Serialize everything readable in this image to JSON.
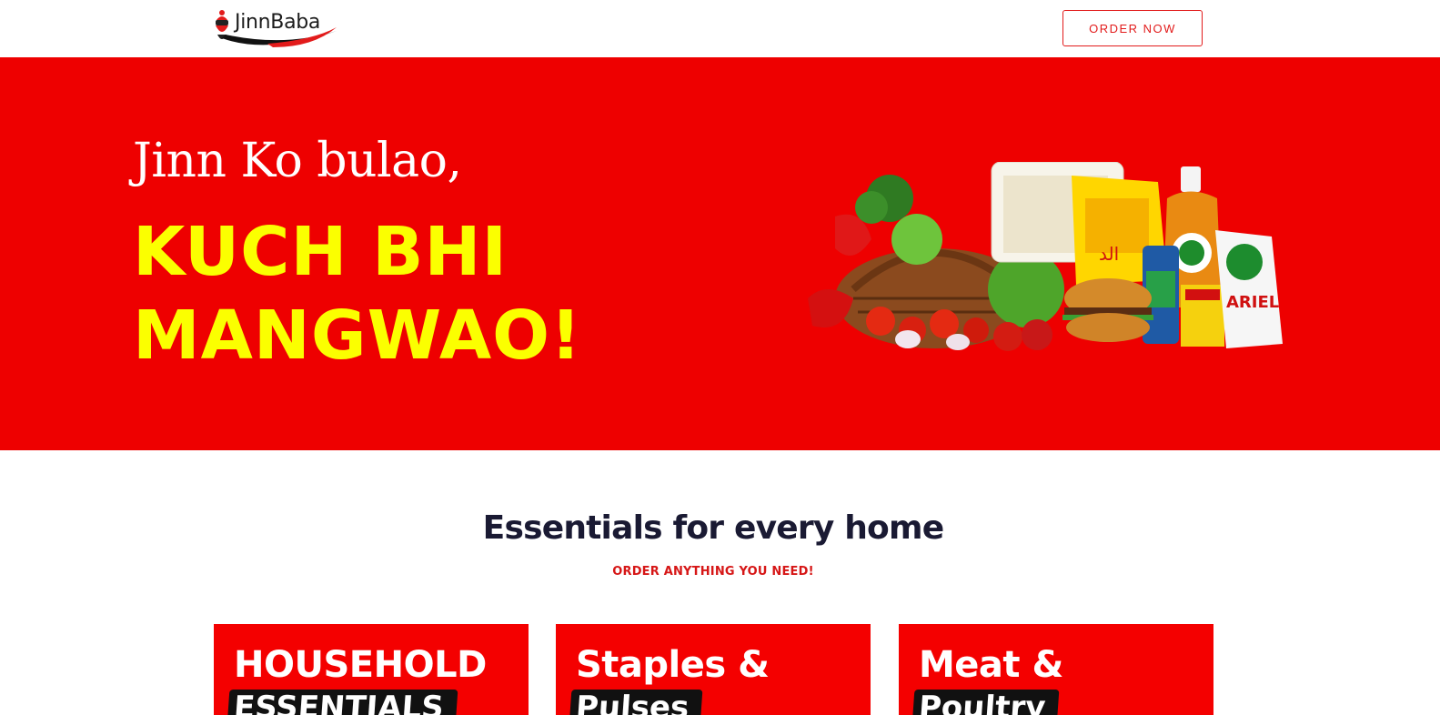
{
  "header": {
    "logo_text": "JinnBaba",
    "order_button": "ORDER NOW"
  },
  "hero": {
    "tagline": "Jinn Ko bulao,",
    "headline_1": "KUCH BHI",
    "headline_2": "MANGWAO!",
    "image_label": "grocery-products-image"
  },
  "section": {
    "title": "Essentials for every home",
    "subtitle": "ORDER ANYTHING YOU NEED!"
  },
  "cards": [
    {
      "line1": "HOUSEHOLD",
      "line2": "ESSENTIALS"
    },
    {
      "line1": "Staples &",
      "line2": "Pulses"
    },
    {
      "line1": "Meat &",
      "line2": "Poultry"
    }
  ],
  "colors": {
    "brand_red": "#ee0000",
    "headline_yellow": "#fbff00",
    "title_navy": "#1a1a33"
  }
}
